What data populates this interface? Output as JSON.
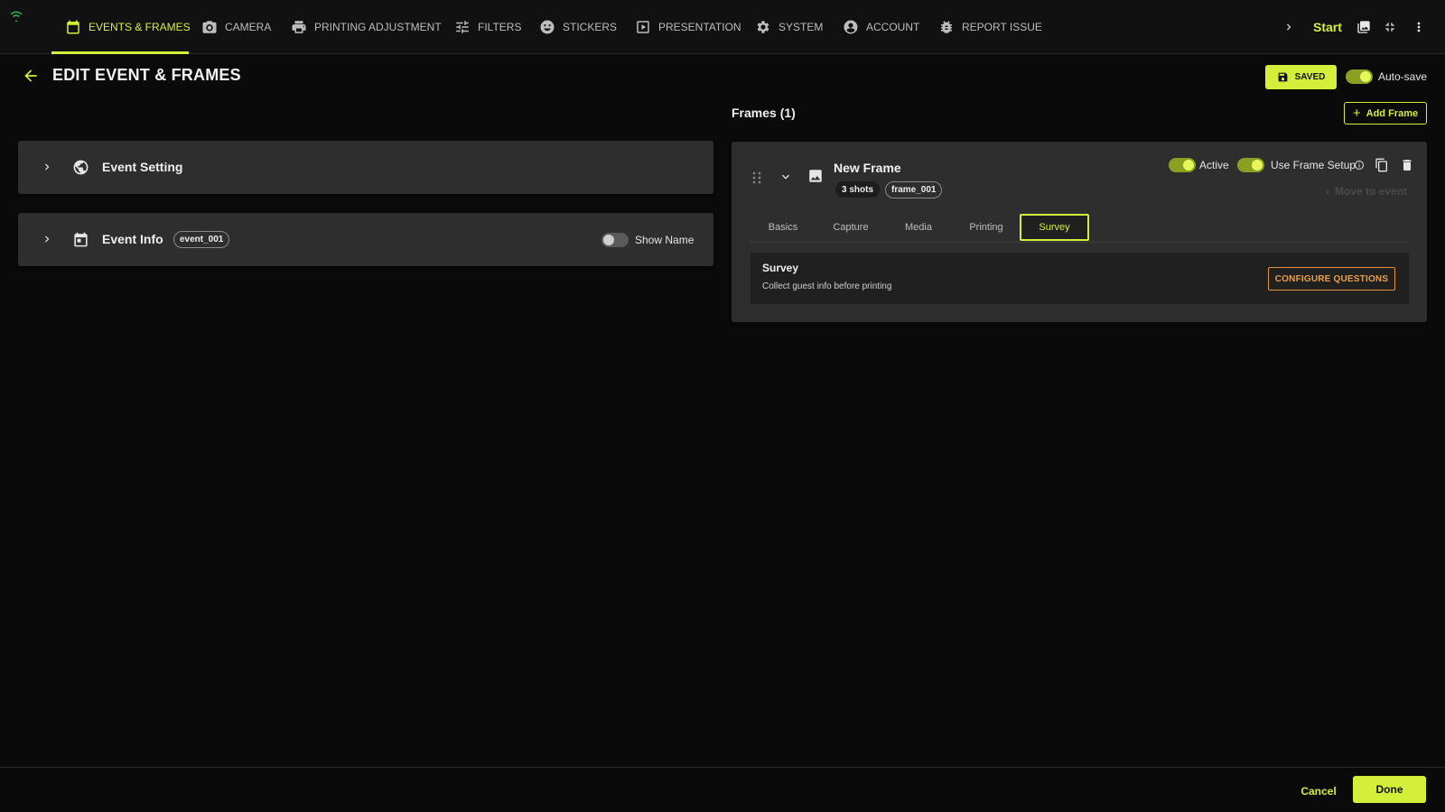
{
  "nav": {
    "items": [
      {
        "label": "EVENTS & FRAMES",
        "icon": "calendar-icon"
      },
      {
        "label": "CAMERA",
        "icon": "camera-icon"
      },
      {
        "label": "PRINTING ADJUSTMENT",
        "icon": "printer-icon"
      },
      {
        "label": "FILTERS",
        "icon": "sliders-icon"
      },
      {
        "label": "STICKERS",
        "icon": "smiley-icon"
      },
      {
        "label": "PRESENTATION",
        "icon": "play-icon"
      },
      {
        "label": "SYSTEM",
        "icon": "gear-icon"
      },
      {
        "label": "ACCOUNT",
        "icon": "account-icon"
      },
      {
        "label": "REPORT ISSUE",
        "icon": "bug-icon"
      }
    ],
    "active_index": 0,
    "start_label": "Start"
  },
  "header": {
    "title": "EDIT EVENT & FRAMES",
    "saved_label": "SAVED",
    "autosave_label": "Auto-save",
    "autosave_on": true
  },
  "event_panel": {
    "setting_title": "Event Setting",
    "info_title": "Event Info",
    "info_chip": "event_001",
    "show_name_label": "Show Name",
    "show_name_on": false
  },
  "frames": {
    "title": "Frames (1)",
    "add_label": "Add Frame",
    "frame": {
      "name": "New Frame",
      "shots": "3 shots",
      "id": "frame_001",
      "active_label": "Active",
      "active_on": true,
      "use_setup_label": "Use Frame Setup",
      "use_setup_on": true,
      "move_label": "Move to event",
      "tabs": [
        "Basics",
        "Capture",
        "Media",
        "Printing",
        "Survey"
      ],
      "active_tab": 4,
      "survey": {
        "title": "Survey",
        "subtitle": "Collect guest info before printing",
        "configure_label": "CONFIGURE QUESTIONS"
      }
    }
  },
  "footer": {
    "cancel_label": "Cancel",
    "done_label": "Done"
  },
  "colors": {
    "accent": "#d4ef3a",
    "warning": "#e0913a",
    "card": "#2e2e2e",
    "background": "#0a0a0a"
  }
}
